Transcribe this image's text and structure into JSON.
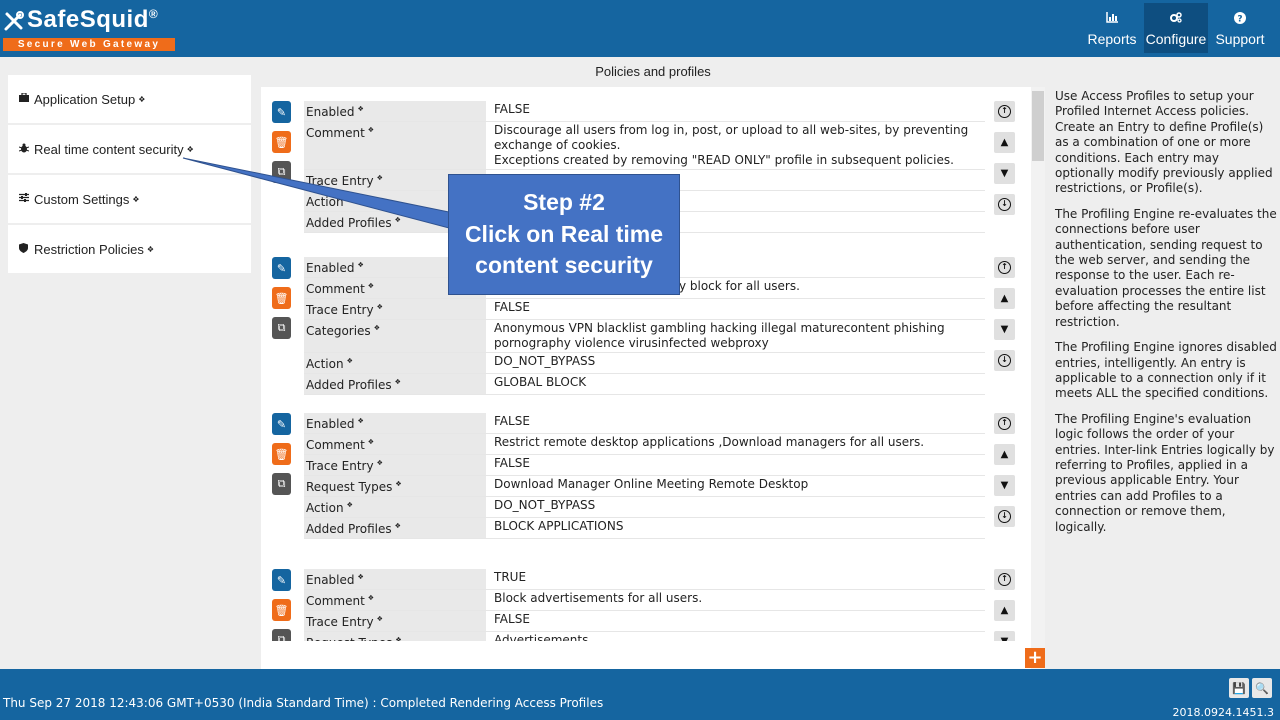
{
  "header": {
    "brand": "SafeSquid",
    "brand_mark": "®",
    "tagline": "Secure Web Gateway",
    "nav": [
      {
        "label": "Reports",
        "icon": "bar-chart-icon"
      },
      {
        "label": "Configure",
        "icon": "cogs-icon"
      },
      {
        "label": "Support",
        "icon": "question-circle-icon"
      }
    ]
  },
  "sidebar": {
    "items": [
      {
        "label": "Application Setup",
        "icon": "briefcase-icon"
      },
      {
        "label": "Real time content security",
        "icon": "bug-icon"
      },
      {
        "label": "Custom Settings",
        "icon": "sliders-icon"
      },
      {
        "label": "Restriction Policies",
        "icon": "shield-icon"
      }
    ]
  },
  "main": {
    "title": "Policies and profiles",
    "entries": [
      {
        "rows": [
          {
            "key": "Enabled",
            "value": [
              "FALSE"
            ]
          },
          {
            "key": "Comment",
            "value": [
              "Discourage all users from log in, post, or upload to all web-sites, by preventing exchange of cookies.",
              "Exceptions created by removing \"READ ONLY\" profile in subsequent policies."
            ]
          },
          {
            "key": "Trace Entry",
            "value": [
              ""
            ]
          },
          {
            "key": "Action",
            "value": [
              ""
            ]
          },
          {
            "key": "Added Profiles",
            "value": [
              ""
            ]
          }
        ]
      },
      {
        "rows": [
          {
            "key": "Enabled",
            "value": [
              ""
            ]
          },
          {
            "key": "Comment",
            "value": [
              "ictly block for all users."
            ]
          },
          {
            "key": "Trace Entry",
            "value": [
              "FALSE"
            ]
          },
          {
            "key": "Categories",
            "value": [
              "Anonymous VPN  blacklist  gambling  hacking  illegal  maturecontent  phishing",
              "pornography  violence  virusinfected  webproxy"
            ]
          },
          {
            "key": "Action",
            "value": [
              "DO_NOT_BYPASS"
            ]
          },
          {
            "key": "Added Profiles",
            "value": [
              "GLOBAL BLOCK"
            ]
          }
        ]
      },
      {
        "rows": [
          {
            "key": "Enabled",
            "value": [
              "FALSE"
            ]
          },
          {
            "key": "Comment",
            "value": [
              "Restrict remote desktop applications ,Download managers for all users."
            ]
          },
          {
            "key": "Trace Entry",
            "value": [
              "FALSE"
            ]
          },
          {
            "key": "Request Types",
            "value": [
              "Download Manager  Online Meeting  Remote Desktop"
            ]
          },
          {
            "key": "Action",
            "value": [
              "DO_NOT_BYPASS"
            ]
          },
          {
            "key": "Added Profiles",
            "value": [
              "BLOCK APPLICATIONS"
            ]
          }
        ]
      },
      {
        "rows": [
          {
            "key": "Enabled",
            "value": [
              "TRUE"
            ]
          },
          {
            "key": "Comment",
            "value": [
              "Block advertisements for all users."
            ]
          },
          {
            "key": "Trace Entry",
            "value": [
              "FALSE"
            ]
          },
          {
            "key": "Request Types",
            "value": [
              "Advertisements"
            ]
          }
        ]
      }
    ]
  },
  "help": {
    "paragraphs": [
      "Use Access Profiles to setup your Profiled Internet Access policies. Create an Entry to define Profile(s) as a combination of one or more conditions. Each entry may optionally modify previously applied restrictions, or Profile(s).",
      "The Profiling Engine re-evaluates the connections before user authentication, sending request to the web server, and sending the response to the user. Each re-evaluation processes the entire list before affecting the resultant restriction.",
      "The Profiling Engine ignores disabled entries, intelligently. An entry is applicable to a connection only if it meets ALL the specified conditions.",
      "The Profiling Engine's evaluation logic follows the order of your entries. Inter-link Entries logically by referring to Profiles, applied in a previous applicable Entry. Your entries can add Profiles to a connection or remove them, logically."
    ]
  },
  "callout": {
    "lines": [
      "Step #2",
      "Click on Real time",
      "content security"
    ]
  },
  "footer": {
    "status": "Thu Sep 27 2018 12:43:06 GMT+0530 (India Standard Time) : Completed Rendering Access Profiles",
    "version": "2018.0924.1451.3"
  },
  "colors": {
    "brand_blue": "#1565a0",
    "accent_orange": "#ef6c1a",
    "callout_blue": "#4472c4"
  }
}
